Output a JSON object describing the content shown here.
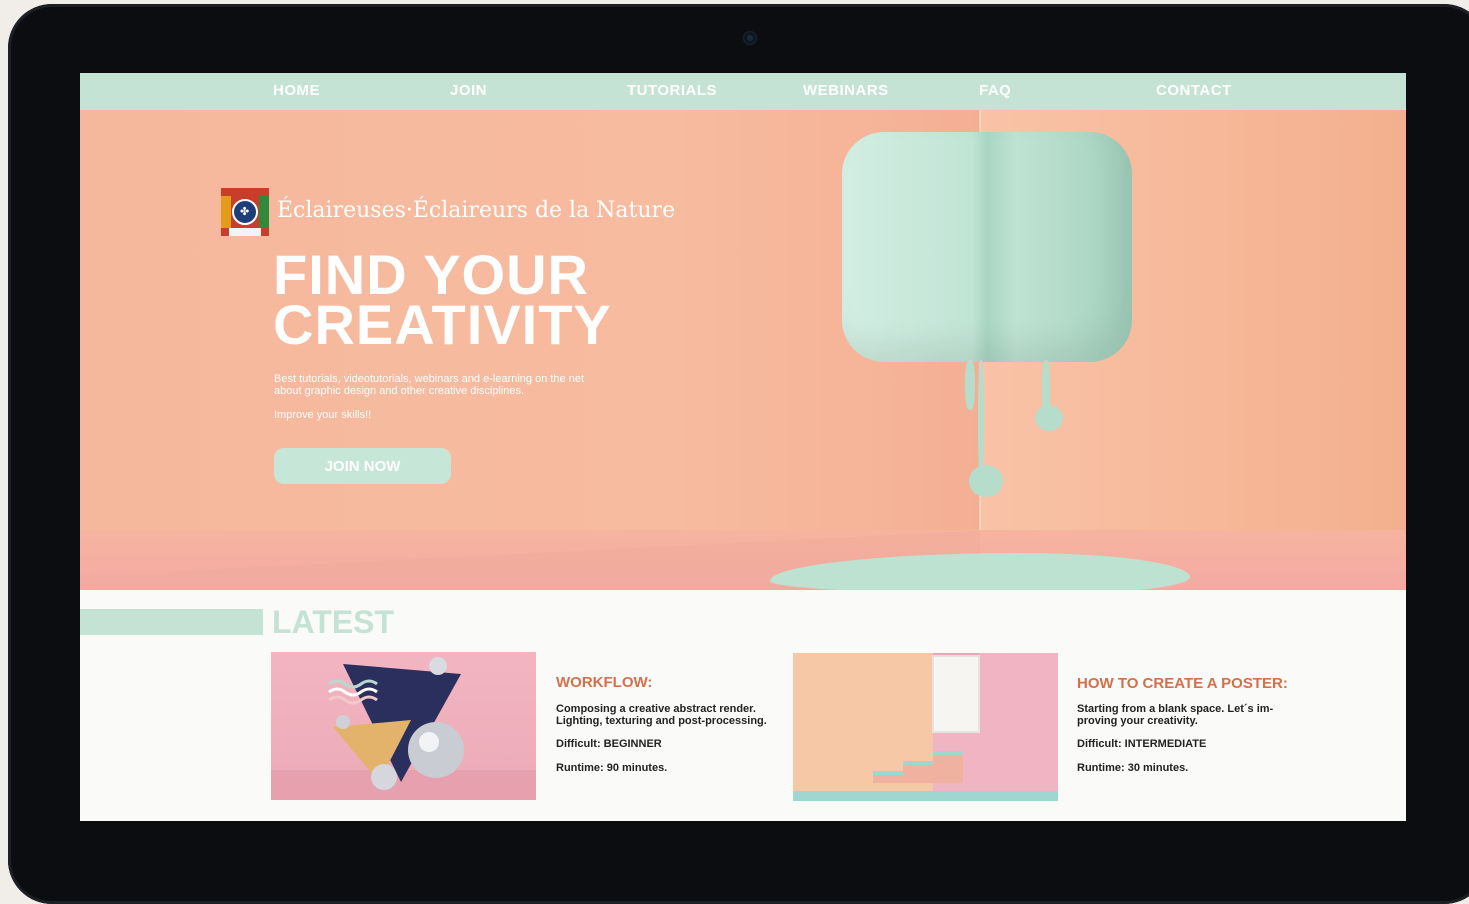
{
  "nav": {
    "items": [
      {
        "label": "HOME"
      },
      {
        "label": "JOIN"
      },
      {
        "label": "TUTORIALS"
      },
      {
        "label": "WEBINARS"
      },
      {
        "label": "FAQ"
      },
      {
        "label": "CONTACT"
      }
    ]
  },
  "hero": {
    "logo_text": "Éclaireuses·Éclaireurs de la Nature",
    "title_line1": "FIND YOUR",
    "title_line2": "CREATIVITY",
    "description": "Best tutorials, videotutorials, webinars and e-learning on the net about graphic design and other creative disciplines.",
    "subtext": "Improve your skills!!",
    "cta_label": "JOIN NOW"
  },
  "latest": {
    "heading": "LATEST",
    "cards": [
      {
        "title": "WORKFLOW:",
        "description": "Composing a creative abstract render. Lighting, texturing and post-processing.",
        "difficulty": "Difficult: BEGINNER",
        "runtime": "Runtime: 90 minutes."
      },
      {
        "title": "HOW TO CREATE A POSTER:",
        "description": "Starting from a blank space. Let´s im-proving your creativity.",
        "difficulty": "Difficult: INTERMEDIATE",
        "runtime": "Runtime: 30 minutes."
      }
    ]
  },
  "colors": {
    "mint": "#c5e3d5",
    "peach": "#f6b89d",
    "accent_orange": "#d2714b"
  }
}
